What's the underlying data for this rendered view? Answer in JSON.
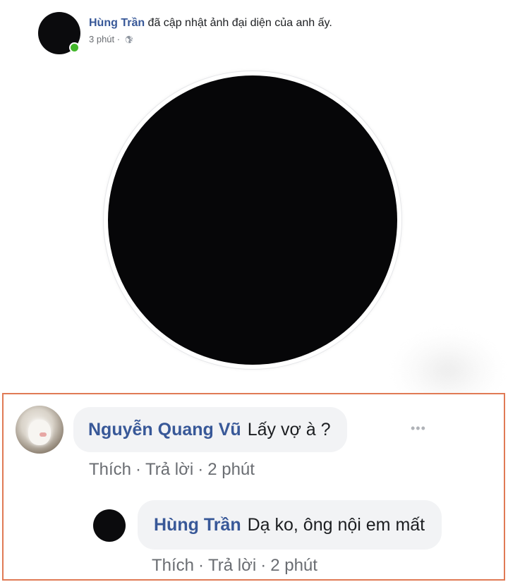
{
  "post": {
    "author": "Hùng Trần",
    "action_text": " đã cập nhật ảnh đại diện của anh ấy.",
    "time": "3 phút",
    "dot": " · ",
    "privacy_icon": "globe-icon",
    "online_color": "#42b72a"
  },
  "comments": [
    {
      "author": "Nguyễn Quang Vũ",
      "text": "Lấy vợ à ?",
      "avatar_icon": "cat-photo-avatar",
      "more": "•••",
      "actions": {
        "like": "Thích",
        "reply": "Trả lời",
        "time": "2 phút"
      },
      "reply": {
        "author": "Hùng Trần",
        "text": "Dạ ko, ông nội em mất",
        "actions": {
          "like": "Thích",
          "reply": "Trả lời",
          "time": "2 phút"
        }
      }
    }
  ],
  "colors": {
    "name_link": "#385898",
    "highlight_border": "#e07a55",
    "bubble_bg": "#f2f3f5",
    "muted_text": "#6a6d72"
  }
}
